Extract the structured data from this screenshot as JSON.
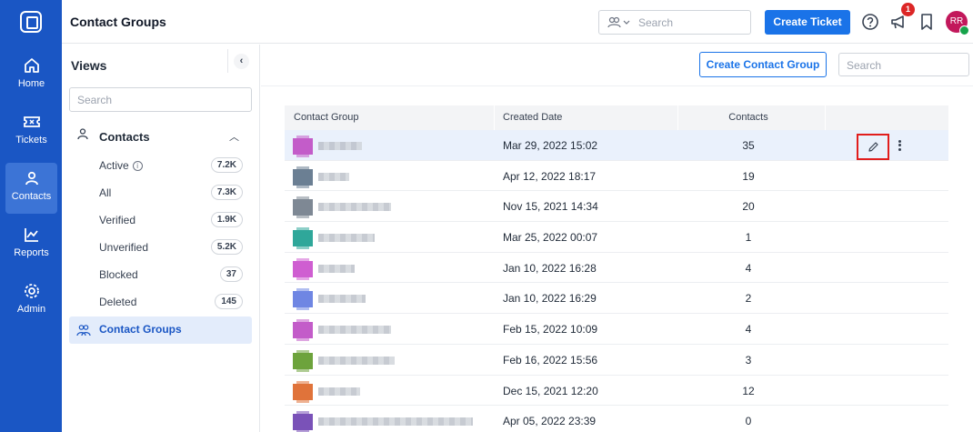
{
  "nav": {
    "items": [
      {
        "label": "Home",
        "icon": "home-icon"
      },
      {
        "label": "Tickets",
        "icon": "ticket-icon"
      },
      {
        "label": "Contacts",
        "icon": "contacts-icon"
      },
      {
        "label": "Reports",
        "icon": "reports-icon"
      },
      {
        "label": "Admin",
        "icon": "gear-icon"
      }
    ],
    "active": "Contacts"
  },
  "header": {
    "title": "Contact Groups",
    "search_placeholder": "Search",
    "create_ticket_label": "Create Ticket",
    "notification_count": "1",
    "avatar_initials": "RR"
  },
  "views": {
    "title": "Views",
    "search_placeholder": "Search",
    "group_label": "Contacts",
    "items": [
      {
        "label": "Active",
        "count": "7.2K"
      },
      {
        "label": "All",
        "count": "7.3K"
      },
      {
        "label": "Verified",
        "count": "1.9K"
      },
      {
        "label": "Unverified",
        "count": "5.2K"
      },
      {
        "label": "Blocked",
        "count": "37"
      },
      {
        "label": "Deleted",
        "count": "145"
      }
    ],
    "selected_label": "Contact Groups"
  },
  "main": {
    "create_group_label": "Create Contact Group",
    "search_placeholder": "Search",
    "columns": [
      "Contact Group",
      "Created Date",
      "Contacts"
    ],
    "rows": [
      {
        "avatar_color": "#c35cc9",
        "created": "Mar 29, 2022 15:02",
        "contacts": "35"
      },
      {
        "avatar_color": "#6b7f93",
        "created": "Apr 12, 2022 18:17",
        "contacts": "19"
      },
      {
        "avatar_color": "#7e8894",
        "created": "Nov 15, 2021 14:34",
        "contacts": "20"
      },
      {
        "avatar_color": "#2fa79a",
        "created": "Mar 25, 2022 00:07",
        "contacts": "1"
      },
      {
        "avatar_color": "#cf5ed1",
        "created": "Jan 10, 2022 16:28",
        "contacts": "4"
      },
      {
        "avatar_color": "#6f86e3",
        "created": "Jan 10, 2022 16:29",
        "contacts": "2"
      },
      {
        "avatar_color": "#c35cc9",
        "created": "Feb 15, 2022 10:09",
        "contacts": "4"
      },
      {
        "avatar_color": "#6da33c",
        "created": "Feb 16, 2022 15:56",
        "contacts": "3"
      },
      {
        "avatar_color": "#e0733a",
        "created": "Dec 15, 2021 12:20",
        "contacts": "12"
      },
      {
        "avatar_color": "#7a52b8",
        "created": "Apr 05, 2022 23:39",
        "contacts": "0"
      }
    ]
  },
  "colors": {
    "nav_bg": "#1a56c4",
    "primary": "#1a73e8",
    "highlight_row": "#eaf1fc",
    "edit_highlight_border": "#e11d1d"
  }
}
